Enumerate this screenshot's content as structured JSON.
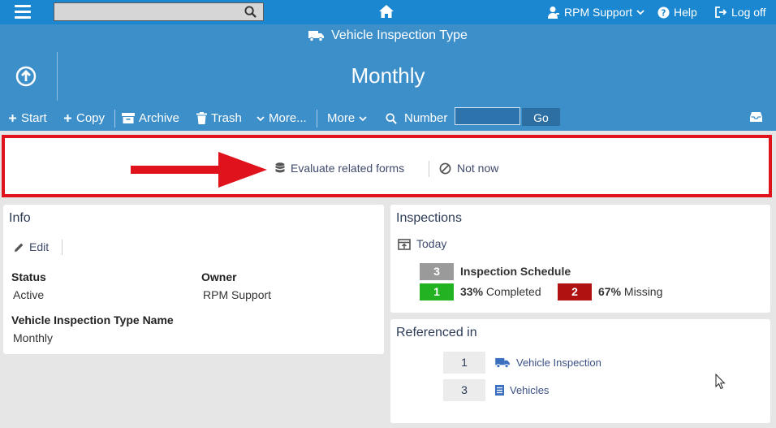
{
  "topbar": {
    "user_label": "RPM Support",
    "help_label": "Help",
    "logoff_label": "Log off",
    "search_value": ""
  },
  "header": {
    "form_type": "Vehicle Inspection Type",
    "record_title": "Monthly"
  },
  "toolbar": {
    "start_label": "Start",
    "copy_label": "Copy",
    "archive_label": "Archive",
    "trash_label": "Trash",
    "more_dots_label": "More...",
    "more_label": "More",
    "number_label": "Number",
    "number_value": "",
    "go_label": "Go"
  },
  "prompt": {
    "evaluate_label": "Evaluate related forms",
    "not_now_label": "Not now"
  },
  "info": {
    "title": "Info",
    "edit_label": "Edit",
    "status_label": "Status",
    "status_value": "Active",
    "owner_label": "Owner",
    "owner_value": "RPM Support",
    "name_label": "Vehicle Inspection Type Name",
    "name_value": "Monthly"
  },
  "inspections": {
    "title": "Inspections",
    "today_label": "Today",
    "schedule_count": "3",
    "schedule_label": "Inspection Schedule",
    "completed_count": "1",
    "completed_pct": "33%",
    "completed_label": "Completed",
    "missing_count": "2",
    "missing_pct": "67%",
    "missing_label": "Missing"
  },
  "referenced": {
    "title": "Referenced in",
    "items": [
      {
        "count": "1",
        "label": "Vehicle Inspection"
      },
      {
        "count": "3",
        "label": "Vehicles"
      }
    ]
  },
  "colors": {
    "topbar": "#1b87d0",
    "band": "#3d8fc9",
    "highlight_border": "#e0121b",
    "badge_gray": "#9a9a9a",
    "badge_green": "#22b222",
    "badge_red": "#b01212"
  }
}
